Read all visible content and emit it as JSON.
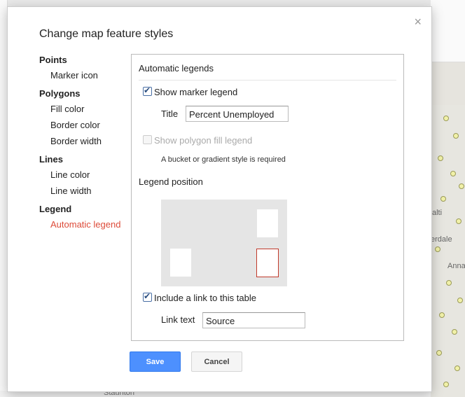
{
  "dialog": {
    "title": "Change map feature styles",
    "close_icon": "×"
  },
  "nav": {
    "points": {
      "title": "Points",
      "items": [
        "Marker icon"
      ]
    },
    "polygons": {
      "title": "Polygons",
      "items": [
        "Fill color",
        "Border color",
        "Border width"
      ]
    },
    "lines": {
      "title": "Lines",
      "items": [
        "Line color",
        "Line width"
      ]
    },
    "legend": {
      "title": "Legend",
      "items": [
        "Automatic legend"
      ]
    },
    "active_color": "#dd4b39"
  },
  "panel": {
    "header": "Automatic legends",
    "show_marker_legend": {
      "label": "Show marker legend",
      "checked": true
    },
    "title_field": {
      "label": "Title",
      "value": "Percent Unemployed"
    },
    "show_polygon_legend": {
      "label": "Show polygon fill legend",
      "checked": false,
      "disabled": true
    },
    "polygon_hint": "A bucket or gradient style is required",
    "legend_position_label": "Legend position",
    "include_link": {
      "label": "Include a link to this table",
      "checked": true
    },
    "link_text_field": {
      "label": "Link text",
      "value": "Source"
    }
  },
  "buttons": {
    "save": "Save",
    "cancel": "Cancel",
    "save_color": "#4d90fe"
  },
  "background": {
    "map_labels": [
      "alti",
      "erdale",
      "Anna",
      "Staunton"
    ]
  }
}
